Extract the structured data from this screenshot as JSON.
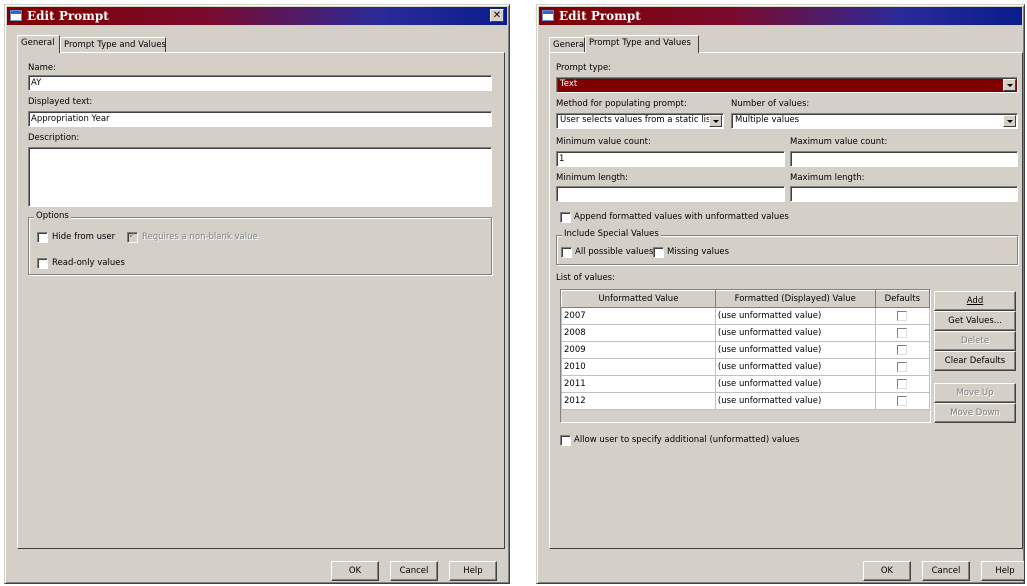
{
  "dialog1": {
    "title": "Edit Prompt",
    "close": "✕",
    "tabs": [
      "General",
      "Prompt Type and Values"
    ],
    "name_label": "Name:",
    "name_value": "AY",
    "displayed_label": "Displayed text:",
    "displayed_value": "Appropriation Year",
    "description_label": "Description:",
    "options_legend": "Options",
    "hide_label": "Hide from user",
    "requires_label": "Requires a non-blank value",
    "readonly_label": "Read-only values",
    "ok": "OK",
    "cancel": "Cancel",
    "help": "Help"
  },
  "dialog2": {
    "title": "Edit Prompt",
    "tabs": [
      "General",
      "Prompt Type and Values"
    ],
    "prompt_type_label": "Prompt type:",
    "prompt_type_value": "Text",
    "method_label": "Method for populating prompt:",
    "method_value": "User selects values from a static list",
    "numvals_label": "Number of values:",
    "numvals_value": "Multiple values",
    "min_count_label": "Minimum value count:",
    "min_count_value": "1",
    "max_count_label": "Maximum value count:",
    "max_count_value": "",
    "min_len_label": "Minimum length:",
    "max_len_label": "Maximum length:",
    "append_label": "Append formatted values with unformatted values",
    "special_legend": "Include Special Values",
    "all_possible_label": "All possible values",
    "missing_label": "Missing values",
    "list_label": "List of values:",
    "table": {
      "headers": [
        "Unformatted Value",
        "Formatted (Displayed) Value",
        "Defaults"
      ],
      "rows": [
        {
          "u": "2007",
          "f": "(use unformatted value)"
        },
        {
          "u": "2008",
          "f": "(use unformatted value)"
        },
        {
          "u": "2009",
          "f": "(use unformatted value)"
        },
        {
          "u": "2010",
          "f": "(use unformatted value)"
        },
        {
          "u": "2011",
          "f": "(use unformatted value)"
        },
        {
          "u": "2012",
          "f": "(use unformatted value)"
        }
      ]
    },
    "add": "Add",
    "get_values": "Get Values...",
    "delete": "Delete",
    "clear_defaults": "Clear Defaults",
    "move_up": "Move Up",
    "move_down": "Move Down",
    "allow_label": "Allow user to specify additional (unformatted) values",
    "ok": "OK",
    "cancel": "Cancel",
    "help": "Help"
  },
  "colors": {
    "title_active": "#800000",
    "title_end": "#0a1c8c",
    "dialog_bg": "#d4d0c8",
    "selection": "#800000"
  }
}
